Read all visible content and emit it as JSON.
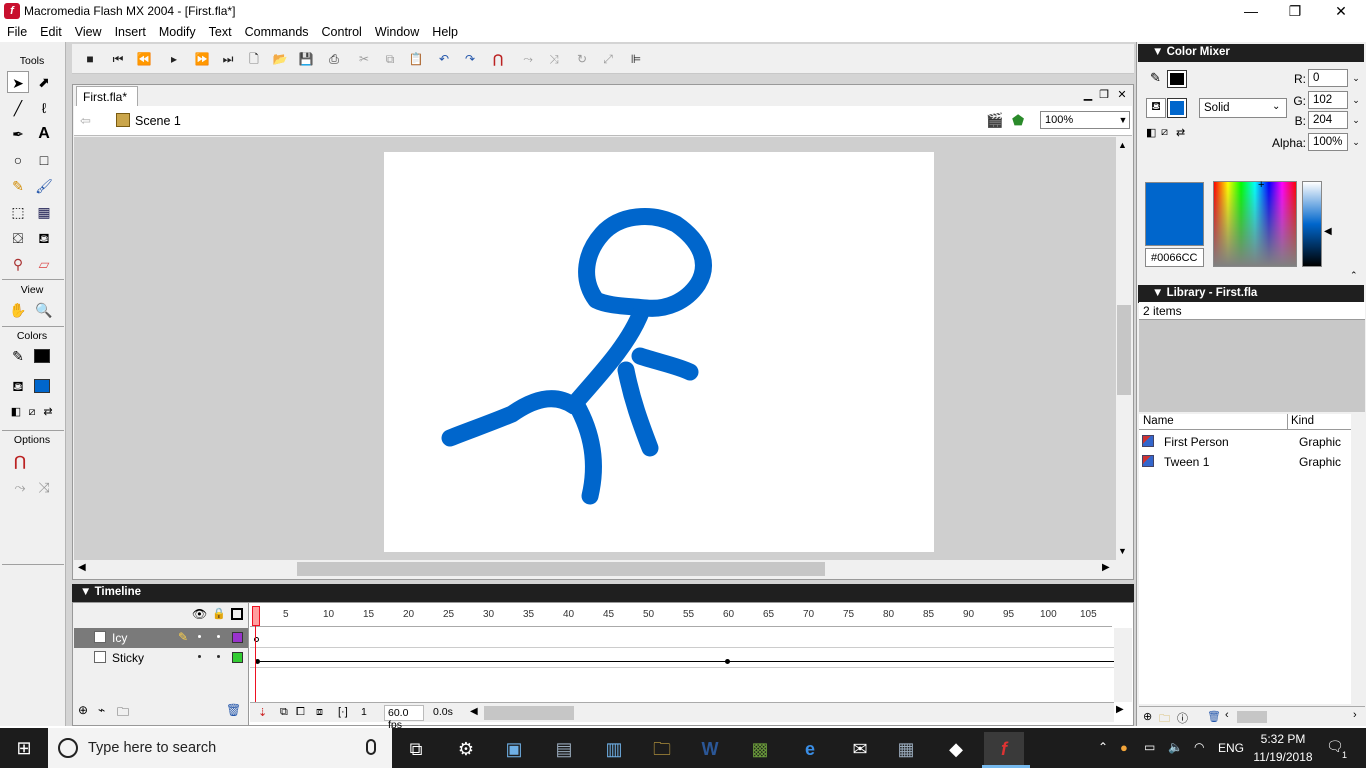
{
  "window": {
    "title": "Macromedia Flash MX 2004 - [First.fla*]",
    "logo": "f",
    "min_icon": "—",
    "max_icon": "❐",
    "close_icon": "✕"
  },
  "menu": [
    "File",
    "Edit",
    "View",
    "Insert",
    "Modify",
    "Text",
    "Commands",
    "Control",
    "Window",
    "Help"
  ],
  "tools": {
    "label": "Tools",
    "view_label": "View",
    "colors_label": "Colors",
    "options_label": "Options",
    "stroke_color": "#000000",
    "fill_color": "#0066CC"
  },
  "document": {
    "tab": "First.fla*",
    "scene": "Scene 1",
    "zoom": "100%",
    "stage_color": "#FFFFFF",
    "drawing_color": "#0066CC"
  },
  "timeline": {
    "title": "Timeline",
    "layers": [
      {
        "name": "Icy",
        "color": "#9933CC"
      },
      {
        "name": "Sticky",
        "color": "#33CC33"
      }
    ],
    "ruler": [
      "5",
      "10",
      "15",
      "20",
      "25",
      "30",
      "35",
      "40",
      "45",
      "50",
      "55",
      "60",
      "65",
      "70",
      "75",
      "80",
      "85",
      "90",
      "95",
      "100",
      "105"
    ],
    "current_frame": "1",
    "fps": "60.0 fps",
    "elapsed": "0.0s"
  },
  "color_mixer": {
    "title": "Color Mixer",
    "r_label": "R:",
    "g_label": "G:",
    "b_label": "B:",
    "alpha_label": "Alpha:",
    "r": "0",
    "g": "102",
    "b": "204",
    "alpha": "100%",
    "fill_type": "Solid",
    "hex": "#0066CC"
  },
  "library": {
    "title": "Library - First.fla",
    "count": "2 items",
    "col_name": "Name",
    "col_kind": "Kind",
    "items": [
      {
        "name": "First Person",
        "kind": "Graphic"
      },
      {
        "name": "Tween 1",
        "kind": "Graphic"
      }
    ]
  },
  "taskbar": {
    "search_placeholder": "Type here to search",
    "lang": "ENG",
    "time": "5:32 PM",
    "date": "11/19/2018",
    "notification_count": "1"
  }
}
